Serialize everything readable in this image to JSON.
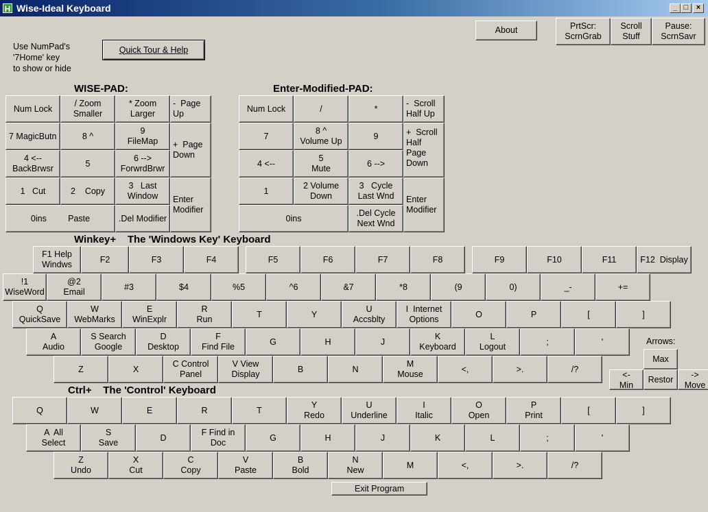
{
  "window": {
    "title": "Wise-Ideal Keyboard",
    "app_icon": "H"
  },
  "controls": {
    "minimize": "_",
    "maximize": "□",
    "close": "×"
  },
  "hint": "Use NumPad's\n'7Home' key\nto show or hide",
  "buttons": {
    "quick_tour": "Quick Tour & Help",
    "about": "About",
    "prtscr": "PrtScr:\nScrnGrab",
    "scroll": "Scroll\nStuff",
    "pause": "Pause:\nScrnSavr",
    "exit": "Exit Program"
  },
  "headers": {
    "wise_pad": "WISE-PAD:",
    "enter_pad": "Enter-Modified-PAD:",
    "winkey": "Winkey+    The 'Windows Key' Keyboard",
    "ctrl": "Ctrl+    The 'Control' Keyboard",
    "arrows": "Arrows:"
  },
  "wise_pad": {
    "numlock": "Num Lock",
    "divide": "/ Zoom\nSmaller",
    "multiply": "* Zoom\nLarger",
    "minus": "-  Page\nUp",
    "k7": "7 MagicButn",
    "k8": "8 ^",
    "k9": "9\nFileMap",
    "plus": "+  Page\nDown",
    "k4": "4 <--\nBackBrwsr",
    "k5": "5",
    "k6": "6 -->\nForwrdBrwr",
    "k1": "1   Cut",
    "k2": "2    Copy",
    "k3": "3   Last\nWindow",
    "enter": "Enter\nModifier",
    "k0": "0ins         Paste",
    "del": ".Del Modifier"
  },
  "enter_pad": {
    "numlock": "Num Lock",
    "divide": "/",
    "multiply": "*",
    "minus": "-  Scroll\nHalf Up",
    "k7": "7",
    "k8": "8 ^\nVolume Up",
    "k9": "9",
    "plus": "+  Scroll\nHalf\nPage\nDown",
    "k4": "4 <--",
    "k5": "5\nMute",
    "k6": "6 -->",
    "k1": "1",
    "k2": "2 Volume\nDown",
    "k3": "3   Cycle\nLast Wnd",
    "enter": "Enter\nModifier",
    "k0": "0ins",
    "del": ".Del Cycle\nNext Wnd"
  },
  "winkey": {
    "fkeys": [
      "F1 Help\nWindws",
      "F2",
      "F3",
      "F4",
      "F5",
      "F6",
      "F7",
      "F8",
      "F9",
      "F10",
      "F11",
      "F12  Display"
    ],
    "numrow": [
      "!1\nWiseWord",
      "@2\nEmail",
      "#3",
      "$4",
      "%5",
      "^6",
      "&7",
      "*8",
      "(9",
      "0)",
      "_-",
      "+="
    ],
    "qrow": [
      "Q\nQuickSave",
      "W\nWebMarks",
      "E\nWinExplr",
      "R\nRun",
      "T",
      "Y",
      "U\nAccsblty",
      "I  Internet\nOptions",
      "O",
      "P",
      "[",
      "]"
    ],
    "arow": [
      "A\nAudio",
      "S Search\nGoogle",
      "D\nDesktop",
      "F\nFind File",
      "G",
      "H",
      "J",
      "K\nKeyboard",
      "L\nLogout",
      ";",
      "'"
    ],
    "zrow": [
      "Z",
      "X",
      "C Control\nPanel",
      "V View\nDisplay",
      "B",
      "N",
      "M\nMouse",
      "<,",
      ">.",
      "/?"
    ]
  },
  "arrows": {
    "max": "Max",
    "min": "<-\nMin",
    "restor": "Restor",
    "move": "->\nMove"
  },
  "ctrl": {
    "qrow": [
      "Q",
      "W",
      "E",
      "R",
      "T",
      "Y\nRedo",
      "U\nUnderline",
      "I\nItalic",
      "O\nOpen",
      "P\nPrint",
      "[",
      "]"
    ],
    "arow": [
      "A  All\nSelect",
      "S\nSave",
      "D",
      "F Find in\nDoc",
      "G",
      "H",
      "J",
      "K",
      "L",
      ";",
      "'"
    ],
    "zrow": [
      "Z\nUndo",
      "X\nCut",
      "C\nCopy",
      "V\nPaste",
      "B\nBold",
      "N\nNew",
      "M",
      "<,",
      ">.",
      "/?"
    ]
  }
}
